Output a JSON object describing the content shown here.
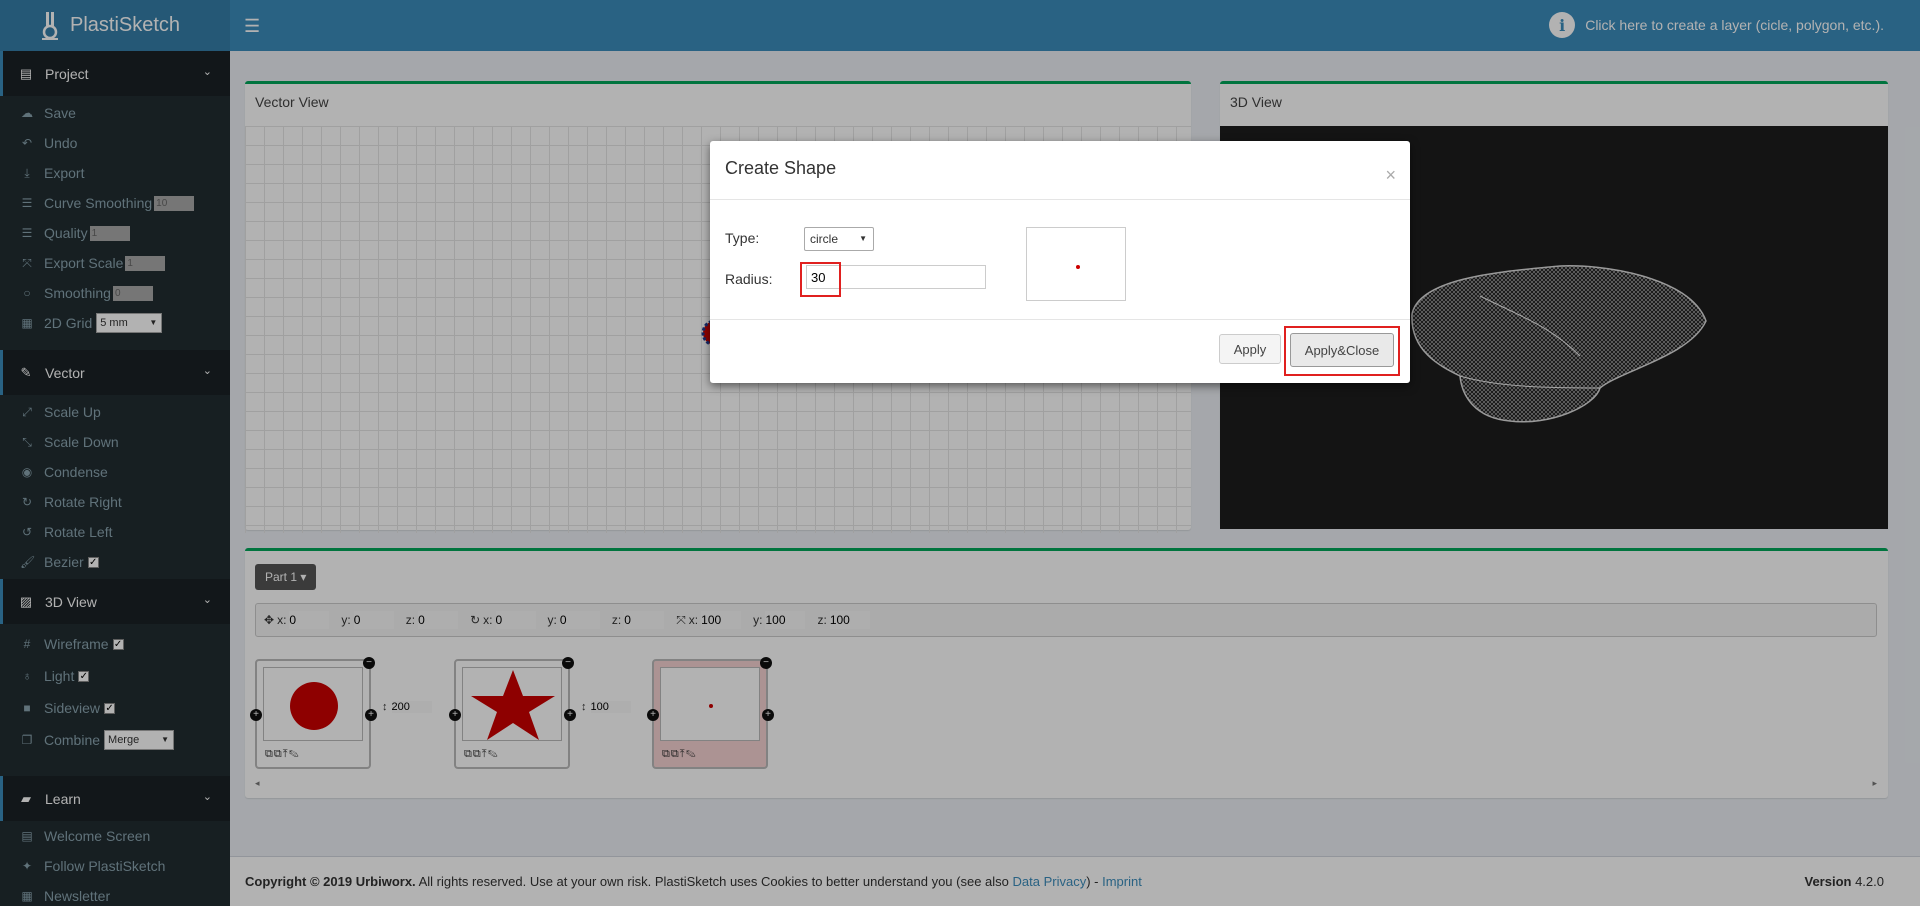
{
  "app": {
    "title": "PlastiSketch"
  },
  "header": {
    "tip": "Click here to create a layer (cicle, polygon, etc.)."
  },
  "sidebar": {
    "project": {
      "title": "Project",
      "items": [
        {
          "label": "Save",
          "icon": "cloud-upload-icon"
        },
        {
          "label": "Undo",
          "icon": "undo-icon"
        },
        {
          "label": "Export",
          "icon": "download-icon"
        },
        {
          "label": "Curve Smoothing",
          "icon": "sliders-icon",
          "value": "10"
        },
        {
          "label": "Quality",
          "icon": "sliders-icon",
          "value": "1"
        },
        {
          "label": "Export Scale",
          "icon": "expand-icon",
          "value": "1"
        },
        {
          "label": "Smoothing",
          "icon": "circle-icon",
          "value": "0"
        },
        {
          "label": "2D Grid",
          "icon": "grid-icon",
          "value": "5 mm"
        }
      ]
    },
    "vector": {
      "title": "Vector",
      "items": [
        {
          "label": "Scale Up",
          "icon": "expand-icon"
        },
        {
          "label": "Scale Down",
          "icon": "compress-icon"
        },
        {
          "label": "Condense",
          "icon": "dot-circle-icon"
        },
        {
          "label": "Rotate Right",
          "icon": "rotate-right-icon"
        },
        {
          "label": "Rotate Left",
          "icon": "rotate-left-icon"
        },
        {
          "label": "Bezier",
          "icon": "brush-icon"
        }
      ]
    },
    "view3d": {
      "title": "3D View",
      "items": [
        {
          "label": "Wireframe",
          "icon": "hashtag-icon"
        },
        {
          "label": "Light",
          "icon": "lightbulb-icon"
        },
        {
          "label": "Sideview",
          "icon": "video-icon"
        },
        {
          "label": "Combine",
          "icon": "copy-icon",
          "value": "Merge"
        }
      ]
    },
    "learn": {
      "title": "Learn",
      "items": [
        {
          "label": "Welcome Screen",
          "icon": "film-icon"
        },
        {
          "label": "Follow PlastiSketch",
          "icon": "twitter-icon"
        },
        {
          "label": "Newsletter",
          "icon": "newspaper-icon"
        }
      ]
    }
  },
  "vector_view": {
    "title": "Vector View"
  },
  "view_3d": {
    "title": "3D View"
  },
  "parts": {
    "part_button": "Part 1 ▾",
    "coords": [
      {
        "label": "x:",
        "value": "0"
      },
      {
        "label": "y:",
        "value": "0"
      },
      {
        "label": "z:",
        "value": "0"
      },
      {
        "label": "x:",
        "value": "0"
      },
      {
        "label": "y:",
        "value": "0"
      },
      {
        "label": "z:",
        "value": "0"
      },
      {
        "label": "x:",
        "value": "100"
      },
      {
        "label": "y:",
        "value": "100"
      },
      {
        "label": "z:",
        "value": "100"
      }
    ],
    "layer_heights": [
      "200",
      "100"
    ]
  },
  "footer": {
    "copyright_bold": "Copyright © 2019 Urbiworx.",
    "copyright_text": " All rights reserved. Use at your own risk. PlastiSketch uses Cookies to better understand you (see also ",
    "privacy": "Data Privacy",
    "after_privacy": ") - ",
    "imprint": "Imprint",
    "version_label": "Version",
    "version": "4.2.0"
  },
  "modal": {
    "title": "Create Shape",
    "type_label": "Type:",
    "type_value": "circle",
    "radius_label": "Radius:",
    "radius_value": "30",
    "apply": "Apply",
    "apply_close": "Apply&Close",
    "close": "×"
  },
  "colors": {
    "header": "#3c8dbc",
    "sidebar": "#222d32",
    "accent_box": "#00a65a",
    "shape": "#c00000",
    "highlight": "#e0201f"
  }
}
